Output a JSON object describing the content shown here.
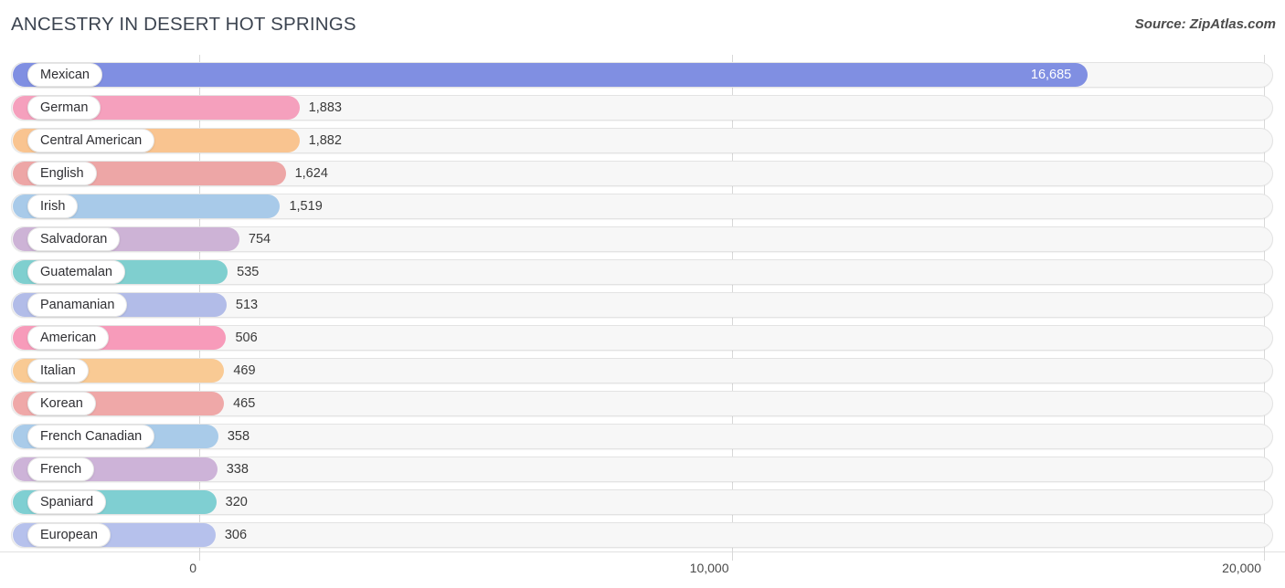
{
  "header": {
    "title": "ANCESTRY IN DESERT HOT SPRINGS",
    "source": "Source: ZipAtlas.com"
  },
  "chart_data": {
    "type": "bar",
    "orientation": "horizontal",
    "title": "ANCESTRY IN DESERT HOT SPRINGS",
    "subtitle": "",
    "xlabel": "",
    "ylabel": "",
    "xlim": [
      0,
      20000
    ],
    "xticks": [
      0,
      10000,
      20000
    ],
    "xtick_labels": [
      "0",
      "10,000",
      "20,000"
    ],
    "grid": true,
    "legend": "none",
    "categories": [
      "Mexican",
      "German",
      "Central American",
      "English",
      "Irish",
      "Salvadoran",
      "Guatemalan",
      "Panamanian",
      "American",
      "Italian",
      "Korean",
      "French Canadian",
      "French",
      "Spaniard",
      "European"
    ],
    "values": [
      16685,
      1883,
      1882,
      1624,
      1519,
      754,
      535,
      513,
      506,
      469,
      465,
      358,
      338,
      320,
      306
    ],
    "value_labels": [
      "16,685",
      "1,883",
      "1,882",
      "1,624",
      "1,519",
      "754",
      "535",
      "513",
      "506",
      "469",
      "465",
      "358",
      "338",
      "320",
      "306"
    ],
    "colors": [
      "#808fe2",
      "#f5a0bd",
      "#f9c490",
      "#eda6a6",
      "#a8cae9",
      "#cdb3d6",
      "#7fcfcf",
      "#b2bce8",
      "#f79bba",
      "#f9ca94",
      "#efa8a8",
      "#a9cbe9",
      "#cdb3d8",
      "#7fcfd2",
      "#b6c1ec"
    ],
    "label_inside_bar": [
      true,
      false,
      false,
      false,
      false,
      false,
      false,
      false,
      false,
      false,
      false,
      false,
      false,
      false,
      false
    ]
  }
}
